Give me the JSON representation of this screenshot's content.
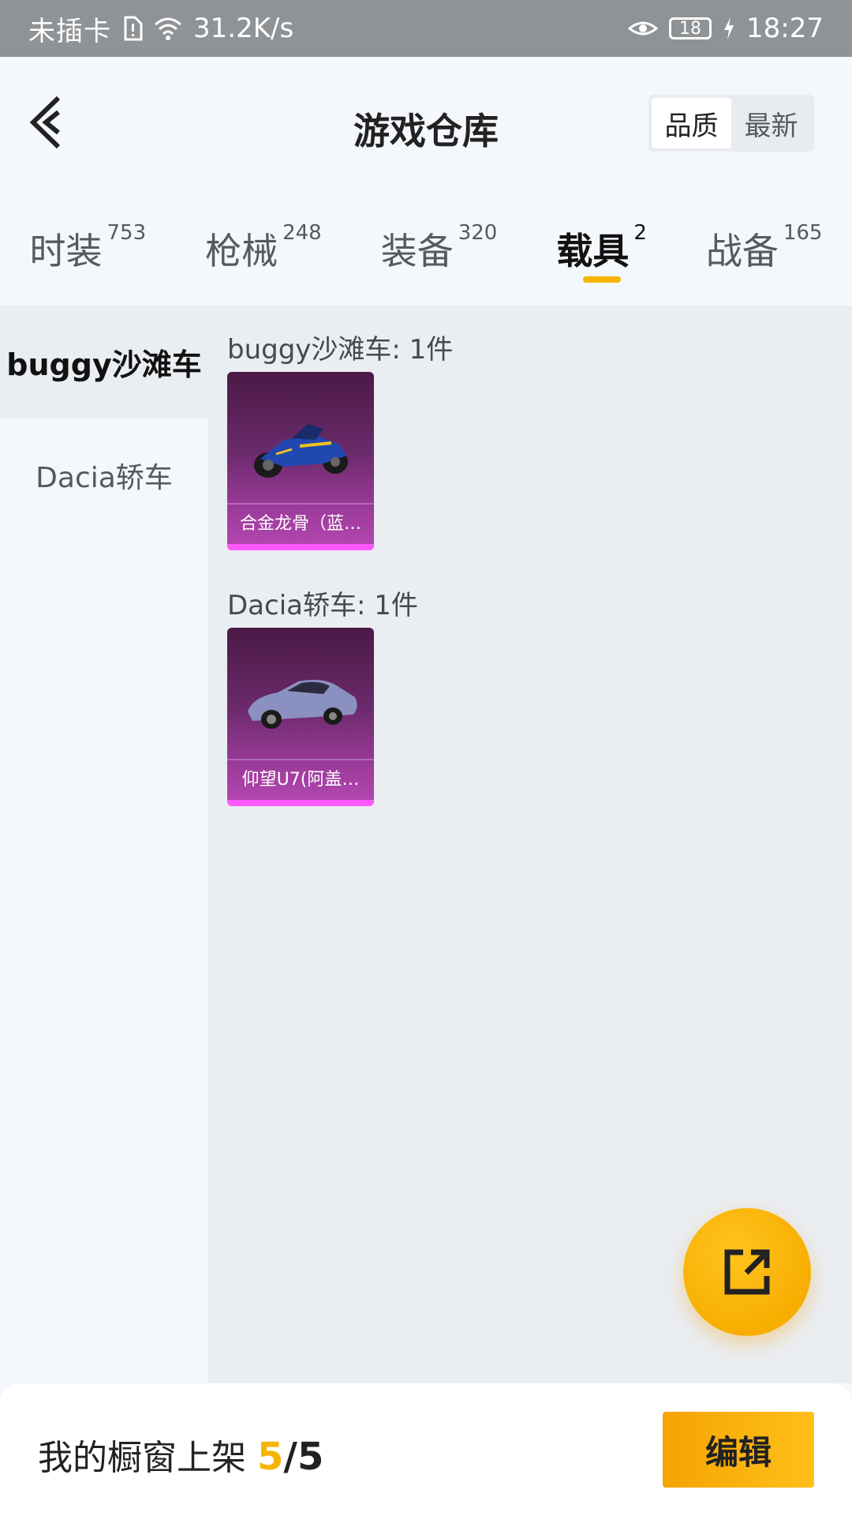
{
  "status_bar": {
    "carrier": "未插卡",
    "speed": "31.2K/s",
    "battery": "18",
    "time": "18:27",
    "icons": [
      "sim-alert-icon",
      "wifi-icon",
      "eye-comfort-icon",
      "battery-icon",
      "charging-icon"
    ]
  },
  "header": {
    "title": "游戏仓库",
    "sort_options": [
      "品质",
      "最新"
    ],
    "active_sort": "品质"
  },
  "tabs": [
    {
      "label": "时装",
      "count": "753"
    },
    {
      "label": "枪械",
      "count": "248"
    },
    {
      "label": "装备",
      "count": "320"
    },
    {
      "label": "载具",
      "count": "2"
    },
    {
      "label": "战备",
      "count": "165"
    }
  ],
  "active_tab": "载具",
  "sidebar": {
    "items": [
      "buggy沙滩车",
      "Dacia轿车"
    ],
    "active": "buggy沙滩车"
  },
  "groups": [
    {
      "title": "buggy沙滩车: 1件",
      "items": [
        {
          "name": "合金龙骨（蓝…"
        }
      ]
    },
    {
      "title": "Dacia轿车: 1件",
      "items": [
        {
          "name": "仰望U7(阿盖…"
        }
      ]
    }
  ],
  "showcase": {
    "label": "我的橱窗上架 ",
    "count": "5",
    "separator": "/",
    "total": "5"
  },
  "edit_label": "编辑",
  "colors": {
    "accent": "#f5b400",
    "card_rarity": "#ff58ff"
  }
}
